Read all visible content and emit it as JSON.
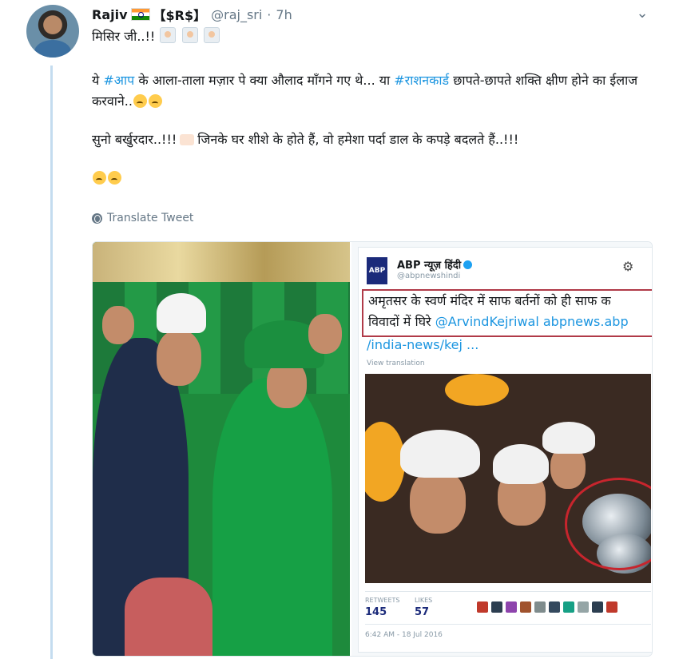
{
  "tweet": {
    "name": "Rajiv",
    "badge": "【$R$】",
    "handle": "@raj_sri",
    "time": "7h",
    "line1": "मिसिर जी..!!",
    "para1_pre": "ये ",
    "hashtag1": "#आप",
    "para1_mid": " के आला-ताला मज़ार पे क्या औलाद माँगने गए थे... या ",
    "hashtag2": "#राशनकार्ड",
    "para1_post": " छापते-छापते शक्ति क्षीण होने का ईलाज करवाने..",
    "para2_pre": "सुनो बर्खुरदार..!!!",
    "para2_post": "जिनके घर शीशे के होते हैं, वो हमेशा पर्दा डाल के कपड़े बदलते हैं..!!!",
    "translate": "Translate Tweet"
  },
  "embed": {
    "logo_text": "ABP",
    "account_name": "ABP न्यूज़ हिंदी",
    "account_handle": "@abpnewshindi",
    "quote_line1": "अमृतसर के स्वर्ण मंदिर में साफ बर्तनों को ही साफ क",
    "quote_line2_pre": "विवादों में घिरे ",
    "quote_mention": "@ArvindKejriwal abpnews.abp",
    "quote_link": "/india-news/kej  ...",
    "view_translation": "View translation",
    "retweets_label": "RETWEETS",
    "retweets": "145",
    "likes_label": "LIKES",
    "likes": "57",
    "timestamp": "6:42 AM - 18 Jul 2016"
  },
  "icons": {
    "flag": "india-flag-icon",
    "caret": "chevron-down-icon",
    "globe": "globe-icon",
    "gear": "gear-icon"
  },
  "colors": {
    "link": "#1b95e0",
    "thread_line": "#c4dcef",
    "secondary_text": "#657786",
    "highlight_border": "#b03a48"
  }
}
